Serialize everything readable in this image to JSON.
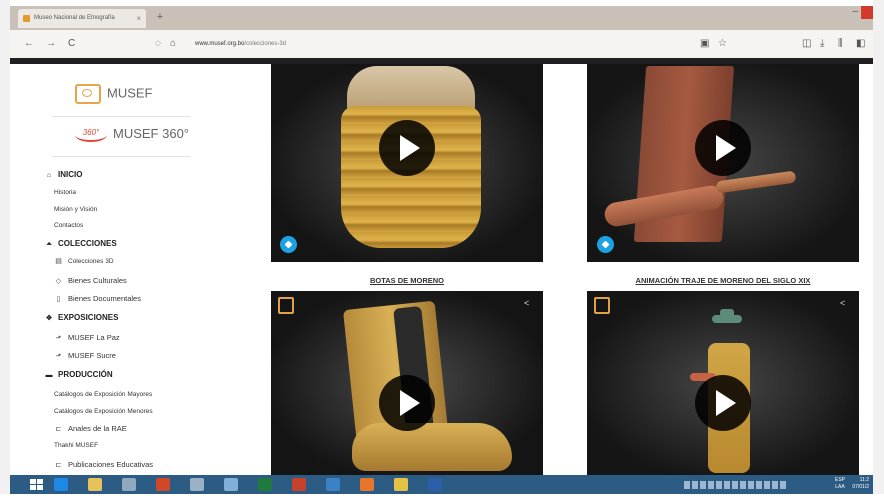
{
  "browser": {
    "tab_title": "Museo Nacional de Etnografía",
    "new_tab": "+",
    "url_domain": "www.musef.org.bo",
    "url_path": "/colecciones-3d",
    "url_prefix": "https://",
    "nav_back": "←",
    "nav_forward": "→",
    "nav_reload": "C",
    "window_minimize": "–"
  },
  "sidebar": {
    "logo_text": "MUSEF",
    "logo360_mark": "360°",
    "logo360_text": "MUSEF 360°",
    "sections": [
      {
        "icon": "home-icon",
        "label": "INICIO",
        "items": [
          "Historia",
          "Misión y Visión",
          "Contactos"
        ]
      },
      {
        "icon": "bank-icon",
        "label": "COLECCIONES",
        "items": [
          "Colecciones 3D",
          "Bienes Culturales",
          "Bienes Documentales"
        ]
      },
      {
        "icon": "gallery-icon",
        "label": "EXPOSICIONES",
        "items": [
          "MUSEF La Paz",
          "MUSEF Sucre"
        ]
      },
      {
        "icon": "book-icon",
        "label": "PRODUCCIÓN",
        "items": [
          "Catálogos de Exposición Mayores",
          "Catálogos de Exposición Menores",
          "Anales de la RAE",
          "Thakhi MUSEF",
          "Publicaciones Educativas"
        ]
      }
    ]
  },
  "cards": [
    {
      "title": "BOTAS DE MORENO"
    },
    {
      "title": "ANIMACIÓN TRAJE DE MORENO DEL SIGLO XIX"
    }
  ],
  "taskbar": {
    "lang_top": "ESP",
    "lang_bottom": "LAA",
    "time": "11:2",
    "date": "07/01/2"
  },
  "colors": {
    "accent_blue": "#1ca1e3",
    "logo_orange": "#e7a64b",
    "taskbar": "#2c5c84"
  }
}
